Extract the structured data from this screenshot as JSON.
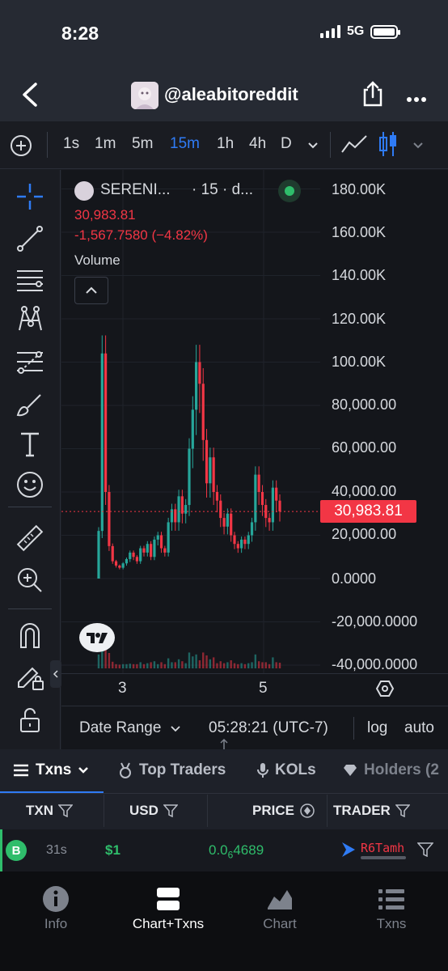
{
  "status_bar": {
    "time": "8:28",
    "network": "5G"
  },
  "header": {
    "handle": "@aleabitoreddit"
  },
  "toolbar": {
    "timeframes": [
      "1s",
      "1m",
      "5m",
      "15m",
      "1h",
      "4h",
      "D"
    ],
    "active_timeframe": "15m"
  },
  "legend": {
    "symbol": "SERENI...",
    "interval": "· 15 · d...",
    "price": "30,983.81",
    "change": "-1,567.7580 (−4.82%)",
    "volume_label": "Volume"
  },
  "chart_data": {
    "type": "candlestick",
    "y_ticks": [
      "180.00K",
      "160.00K",
      "140.00K",
      "120.00K",
      "100.00K",
      "80,000.00",
      "60,000.00",
      "40,000.00",
      "20,000.00",
      "0.0000",
      "-20,000.0000",
      "-40,000.0000"
    ],
    "x_ticks": [
      "3",
      "5"
    ],
    "last_price_label": "30,983.81",
    "last_price": 30983.81,
    "ylim": [
      -40000,
      180000
    ],
    "close_series_approx": [
      22000,
      104000,
      40000,
      15000,
      8000,
      6000,
      5000,
      7000,
      9000,
      12000,
      10000,
      8000,
      14000,
      12000,
      16000,
      10000,
      18000,
      20000,
      14000,
      12000,
      26000,
      32000,
      26000,
      38000,
      30000,
      34000,
      60000,
      78000,
      100000,
      90000,
      64000,
      44000,
      56000,
      40000,
      36000,
      28000,
      24000,
      30000,
      20000,
      16000,
      14000,
      18000,
      16000,
      20000,
      26000,
      48000,
      40000,
      34000,
      28000,
      26000,
      42000,
      36000,
      30983.81
    ],
    "grid": true,
    "color_up": "#26a69a",
    "color_down": "#f23645"
  },
  "bottom_bar": {
    "date_range": "Date Range",
    "clock": "05:28:21 (UTC-7)",
    "log": "log",
    "auto": "auto"
  },
  "tabs": [
    {
      "label": "Txns",
      "active": true
    },
    {
      "label": "Top Traders",
      "active": false
    },
    {
      "label": "KOLs",
      "active": false
    },
    {
      "label": "Holders (2",
      "active": false
    }
  ],
  "table": {
    "headers": [
      "TXN",
      "USD",
      "PRICE",
      "TRADER"
    ],
    "rows": [
      {
        "type": "B",
        "age": "31s",
        "usd": "$1",
        "price_prefix": "0.0",
        "price_sub": "6",
        "price_suffix": "4689",
        "trader": "R6Tamh"
      }
    ]
  },
  "bottom_nav": [
    {
      "label": "Info",
      "icon": "info-icon",
      "active": false
    },
    {
      "label": "Chart+Txns",
      "icon": "chart-txns-icon",
      "active": true
    },
    {
      "label": "Chart",
      "icon": "chart-icon",
      "active": false
    },
    {
      "label": "Txns",
      "icon": "list-icon",
      "active": false
    }
  ]
}
